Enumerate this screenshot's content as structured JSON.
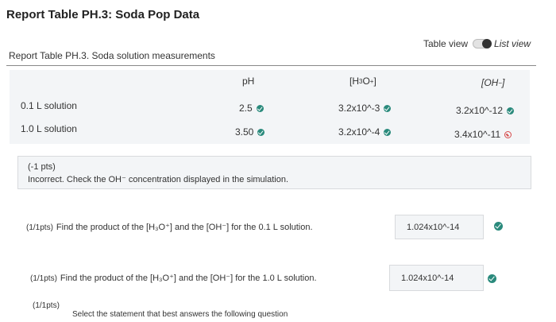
{
  "page_title": "Report Table PH.3: Soda Pop Data",
  "view_toggle": {
    "table_view": "Table view",
    "list_view": "List view"
  },
  "table_caption": "Report Table PH.3. Soda solution measurements",
  "columns": {
    "ph": "pH",
    "h3o_base": "[H",
    "h3o_sub": "3",
    "h3o_mid": "O",
    "h3o_sup": "+",
    "h3o_end": "]",
    "oh_base": "[OH",
    "oh_sup": "−",
    "oh_end": "]"
  },
  "rows": [
    {
      "label": "0.1 L solution",
      "ph": "2.5",
      "h3o": "3.2x10^-3",
      "oh": "3.2x10^-12",
      "oh_status": "correct"
    },
    {
      "label": "1.0 L solution",
      "ph": "3.50",
      "h3o": "3.2x10^-4",
      "oh": "3.4x10^-11",
      "oh_status": "incorrect"
    }
  ],
  "feedback": {
    "pts": "(-1 pts)",
    "text": "Incorrect. Check the OH⁻ concentration displayed in the simulation."
  },
  "questions": [
    {
      "pts": "(1/1pts)",
      "text": "Find the product of the [H₃O⁺] and the [OH⁻] for the 0.1 L solution.",
      "answer": "1.024x10^-14"
    },
    {
      "pts": "(1/1pts)",
      "text": "Find the product of the [H₃O⁺] and the [OH⁻] for the 1.0 L solution.",
      "answer": "1.024x10^-14"
    },
    {
      "pts": "(1/1pts)",
      "text": "Select the statement that best answers the following question"
    }
  ]
}
